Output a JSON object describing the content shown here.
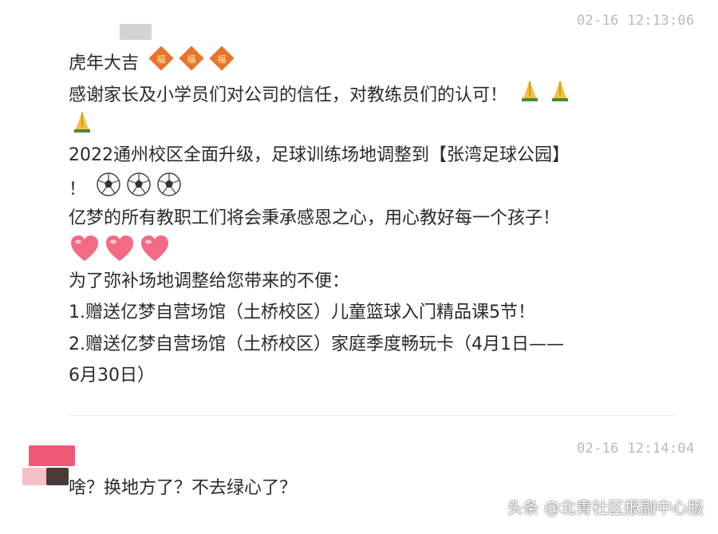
{
  "messages": [
    {
      "timestamp": "02-16 12:13:06",
      "lines": {
        "l1": "虎年大吉",
        "l2": "感谢家长及小学员们对公司的信任，对教练员们的认可！",
        "l4": "2022通州校区全面升级，足球训练场地调整到【张湾足球公园】",
        "l5": "！",
        "l6": "亿梦的所有教职工们将会秉承感恩之心，用心教好每一个孩子！",
        "l8": "为了弥补场地调整给您带来的不便：",
        "l9": "1.赠送亿梦自营场馆（土桥校区）儿童篮球入门精品课5节！",
        "l10": "2.赠送亿梦自营场馆（土桥校区）家庭季度畅玩卡（4月1日——",
        "l11": "6月30日）"
      },
      "emoji": {
        "fortune": "fortune-diamond-icon",
        "pray": "folded-hands-icon",
        "ball": "soccer-ball-icon",
        "heart": "pink-heart-icon"
      }
    },
    {
      "timestamp": "02-16 12:14:04",
      "text": "啥？换地方了？不去绿心了？"
    }
  ],
  "watermark": "头条 @北青社区报副中心版",
  "colors": {
    "fortune_orange": "#e8742a",
    "heart_pink": "#f26a84",
    "pray_yellow": "#f2c03c",
    "timestamp_gray": "#b9b9b9"
  }
}
